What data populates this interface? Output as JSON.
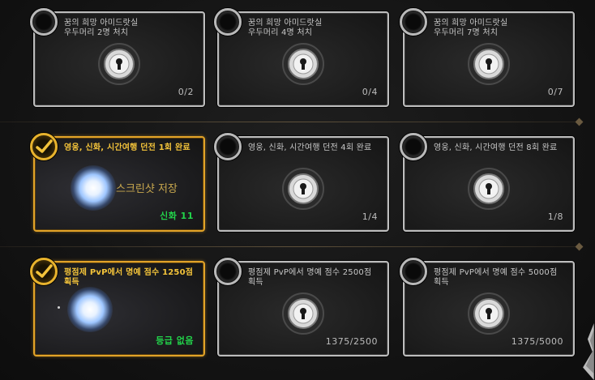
{
  "rows": [
    {
      "cards": [
        {
          "completed": false,
          "title": "꿈의 희망 아미드랏실\n우두머리 2명 처치",
          "progress": "0/2"
        },
        {
          "completed": false,
          "title": "꿈의 희망 아미드랏실\n우두머리 4명 처치",
          "progress": "0/4"
        },
        {
          "completed": false,
          "title": "꿈의 희망 아미드랏실\n우두머리 7명 처치",
          "progress": "0/7"
        }
      ]
    },
    {
      "cards": [
        {
          "completed": true,
          "title": "영웅, 신화, 시간여행 던전 1회 완료",
          "overlay": "스크린샷 저장",
          "reward": "신화 11"
        },
        {
          "completed": false,
          "title": "영웅, 신화, 시간여행 던전 4회 완료",
          "progress": "1/4"
        },
        {
          "completed": false,
          "title": "영웅, 신화, 시간여행 던전 8회 완료",
          "progress": "1/8"
        }
      ]
    },
    {
      "cards": [
        {
          "completed": true,
          "title": "평점제 PvP에서 명예 점수 1250점\n획득",
          "reward": "등급 없음"
        },
        {
          "completed": false,
          "title": "평점제 PvP에서 명예 점수 2500점\n획득",
          "progress": "1375/2500"
        },
        {
          "completed": false,
          "title": "평점제 PvP에서 명예 점수 5000점\n획득",
          "progress": "1375/5000"
        }
      ]
    }
  ],
  "colors": {
    "completed_border": "#e2a328",
    "incomplete_border": "#bdbdbd",
    "reward_text": "#22d34a",
    "completed_title": "#f3c33a"
  },
  "icons": {
    "completed_badge": "checkmark-icon",
    "incomplete_badge": "empty-ring-icon",
    "locked_medal": "keyhole-lock-icon",
    "earned_medal": "glowing-orb-icon"
  }
}
